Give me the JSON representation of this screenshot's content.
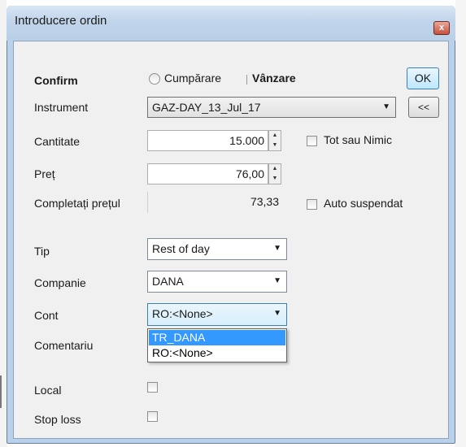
{
  "window": {
    "title": "Introducere ordin",
    "close_glyph": "x"
  },
  "header": {
    "confirm_label": "Confirm",
    "buy_label": "Cumpărare",
    "sell_label": "Vânzare",
    "selected_side": "Vânzare",
    "ok_label": "OK"
  },
  "instrument": {
    "label": "Instrument",
    "value": "GAZ-DAY_13_Jul_17",
    "back_button_label": "<<"
  },
  "quantity": {
    "label": "Cantitate",
    "value": "15.000"
  },
  "all_or_none": {
    "label": "Tot sau Nimic",
    "checked": false
  },
  "price": {
    "label": "Preț",
    "value": "76,00"
  },
  "fill_price": {
    "label": "Completați prețul",
    "value": "73,33"
  },
  "auto_suspend": {
    "label": "Auto suspendat",
    "checked": false
  },
  "type": {
    "label": "Tip",
    "value": "Rest of day"
  },
  "company": {
    "label": "Companie",
    "value": "DANA"
  },
  "account": {
    "label": "Cont",
    "value": "RO:<None>",
    "options": [
      "TR_DANA",
      "RO:<None>"
    ],
    "highlighted_option": "TR_DANA"
  },
  "comment": {
    "label": "Comentariu"
  },
  "local": {
    "label": "Local",
    "checked": false
  },
  "stop_loss": {
    "label": "Stop loss",
    "checked": false
  },
  "colors": {
    "title_bar": "#c0d4ea",
    "client_bg": "#f0f0f0",
    "selection": "#3399ff",
    "close_button": "#c7503b"
  }
}
